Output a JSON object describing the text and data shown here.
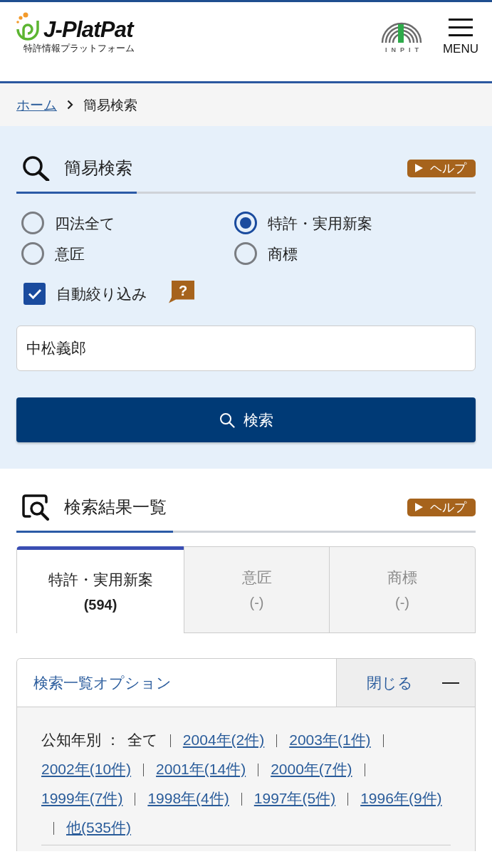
{
  "header": {
    "logo_name": "J-PlatPat",
    "logo_tagline": "特許情報プラットフォーム",
    "partner_logo": "INPIT",
    "menu_label": "MENU"
  },
  "breadcrumb": [
    {
      "label": "ホーム",
      "kind": "link"
    },
    {
      "label": "簡易検索",
      "kind": "current"
    }
  ],
  "simple_search": {
    "title": "簡易検索",
    "help": "ヘルプ",
    "targets": [
      {
        "label": "四法全て",
        "selected": false
      },
      {
        "label": "特許・実用新案",
        "selected": true
      },
      {
        "label": "意匠",
        "selected": false
      },
      {
        "label": "商標",
        "selected": false
      }
    ],
    "auto_filter": {
      "label": "自動絞り込み",
      "checked": true,
      "help": "?"
    },
    "query": {
      "value": "中松義郎"
    },
    "submit": "検索"
  },
  "results": {
    "title": "検索結果一覧",
    "help": "ヘルプ",
    "tabs": [
      {
        "label": "特許・実用新案",
        "count": "(594)",
        "selected": true
      },
      {
        "label": "意匠",
        "count": "(-)",
        "selected": false
      },
      {
        "label": "商標",
        "count": "(-)",
        "selected": false
      }
    ],
    "options": {
      "title": "検索一覧オプション",
      "toggle": "閉じる",
      "expanded": true,
      "filter_label": "公知年別 ：",
      "filter_current": "全て",
      "year_links": [
        "2004年(2件)",
        "2003年(1件)",
        "2002年(10件)",
        "2001年(14件)",
        "2000年(7件)",
        "1999年(7件)",
        "1998年(4件)",
        "1997年(5件)",
        "1996年(9件)",
        "他(535件)"
      ]
    }
  }
}
